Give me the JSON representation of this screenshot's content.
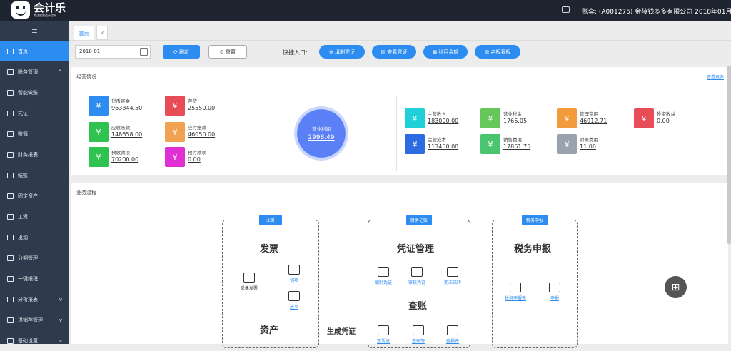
{
  "app": {
    "logo_title": "会计乐",
    "logo_sub": "专注智慧会计提升",
    "account": "账套: (A001275) 金陵钱多多有限公司 2018年01月"
  },
  "icons": {
    "message": "message-icon",
    "menu": "hamburger-icon",
    "calendar": "calendar-icon",
    "grid": "grid-icon"
  },
  "colors": {
    "primary": "#2d8cf0",
    "sidebar": "#2f3a4c",
    "topbar": "#1e2430"
  },
  "sidebar": {
    "toggle": "≡",
    "items": [
      {
        "label": "首页",
        "active": true
      },
      {
        "label": "账务管理",
        "arrow": "^"
      },
      {
        "label": "智能做账"
      },
      {
        "label": "凭证"
      },
      {
        "label": "账簿"
      },
      {
        "label": "财务报表"
      },
      {
        "label": "结账"
      },
      {
        "label": "固定资产"
      },
      {
        "label": "工资"
      },
      {
        "label": "出纳"
      },
      {
        "label": "分期管理"
      },
      {
        "label": "一键报税"
      },
      {
        "label": "分析报表",
        "arrow": "v"
      },
      {
        "label": "进销存管理",
        "arrow": "v"
      },
      {
        "label": "基础设置",
        "arrow": "v"
      }
    ]
  },
  "tabs": {
    "home": "首页",
    "dropdown": "v"
  },
  "toolbar": {
    "date": "2018-01",
    "refresh": "刷新",
    "reset": "重置",
    "quick_label": "快捷入口:",
    "quick": [
      "填制凭证",
      "查看凭证",
      "科目余额",
      "老板看板"
    ]
  },
  "overview": {
    "title": "经营情况",
    "more": "查看更多",
    "left": [
      {
        "label": "货币资金",
        "value": "963844.50",
        "color": "#2d8cf0"
      },
      {
        "label": "存货",
        "value": "25550.00",
        "color": "#e84c57"
      },
      {
        "label": "应收账款",
        "value": "148658.00",
        "color": "#2ec24e"
      },
      {
        "label": "应付账款",
        "value": "46050.00",
        "color": "#f2a253"
      },
      {
        "label": "预收款项",
        "value": "70200.00",
        "color": "#2ec24e"
      },
      {
        "label": "预付款项",
        "value": "0.00",
        "color": "#e02fd2"
      }
    ],
    "profit": {
      "label": "营业利润",
      "value": "2998.49"
    },
    "right": [
      {
        "label": "主营收入",
        "value": "183000.00",
        "color": "#1fd0d8"
      },
      {
        "label": "营业税金",
        "value": "1766.05",
        "color": "#66c85a"
      },
      {
        "label": "管理费用",
        "value": "46912.71",
        "color": "#f29a3c"
      },
      {
        "label": "投资收益",
        "value": "0.00",
        "color": "#e84c57"
      },
      {
        "label": "主营成本",
        "value": "113450.00",
        "color": "#2d6ce0"
      },
      {
        "label": "销售费用",
        "value": "17861.75",
        "color": "#4bc470"
      },
      {
        "label": "财务费用",
        "value": "11.00",
        "color": "#9aa3ad"
      }
    ]
  },
  "process": {
    "title": "业务流程",
    "biz": {
      "badge": "业务",
      "invoice": "发票",
      "purchase": "采集发票",
      "sale": "销项",
      "input": "进项",
      "asset": "资产"
    },
    "fin": {
      "badge": "财务记账",
      "voucher": "凭证管理",
      "fill": "编制凭证",
      "audit": "审核凭证",
      "close": "期末结转",
      "query": "查账",
      "q1": "查凭证",
      "q2": "查账簿",
      "q3": "查报表"
    },
    "gen": "生成凭证",
    "tax": {
      "badge": "税务申报",
      "title": "税务申报",
      "t1": "税务申报表",
      "t2": "申报"
    }
  }
}
